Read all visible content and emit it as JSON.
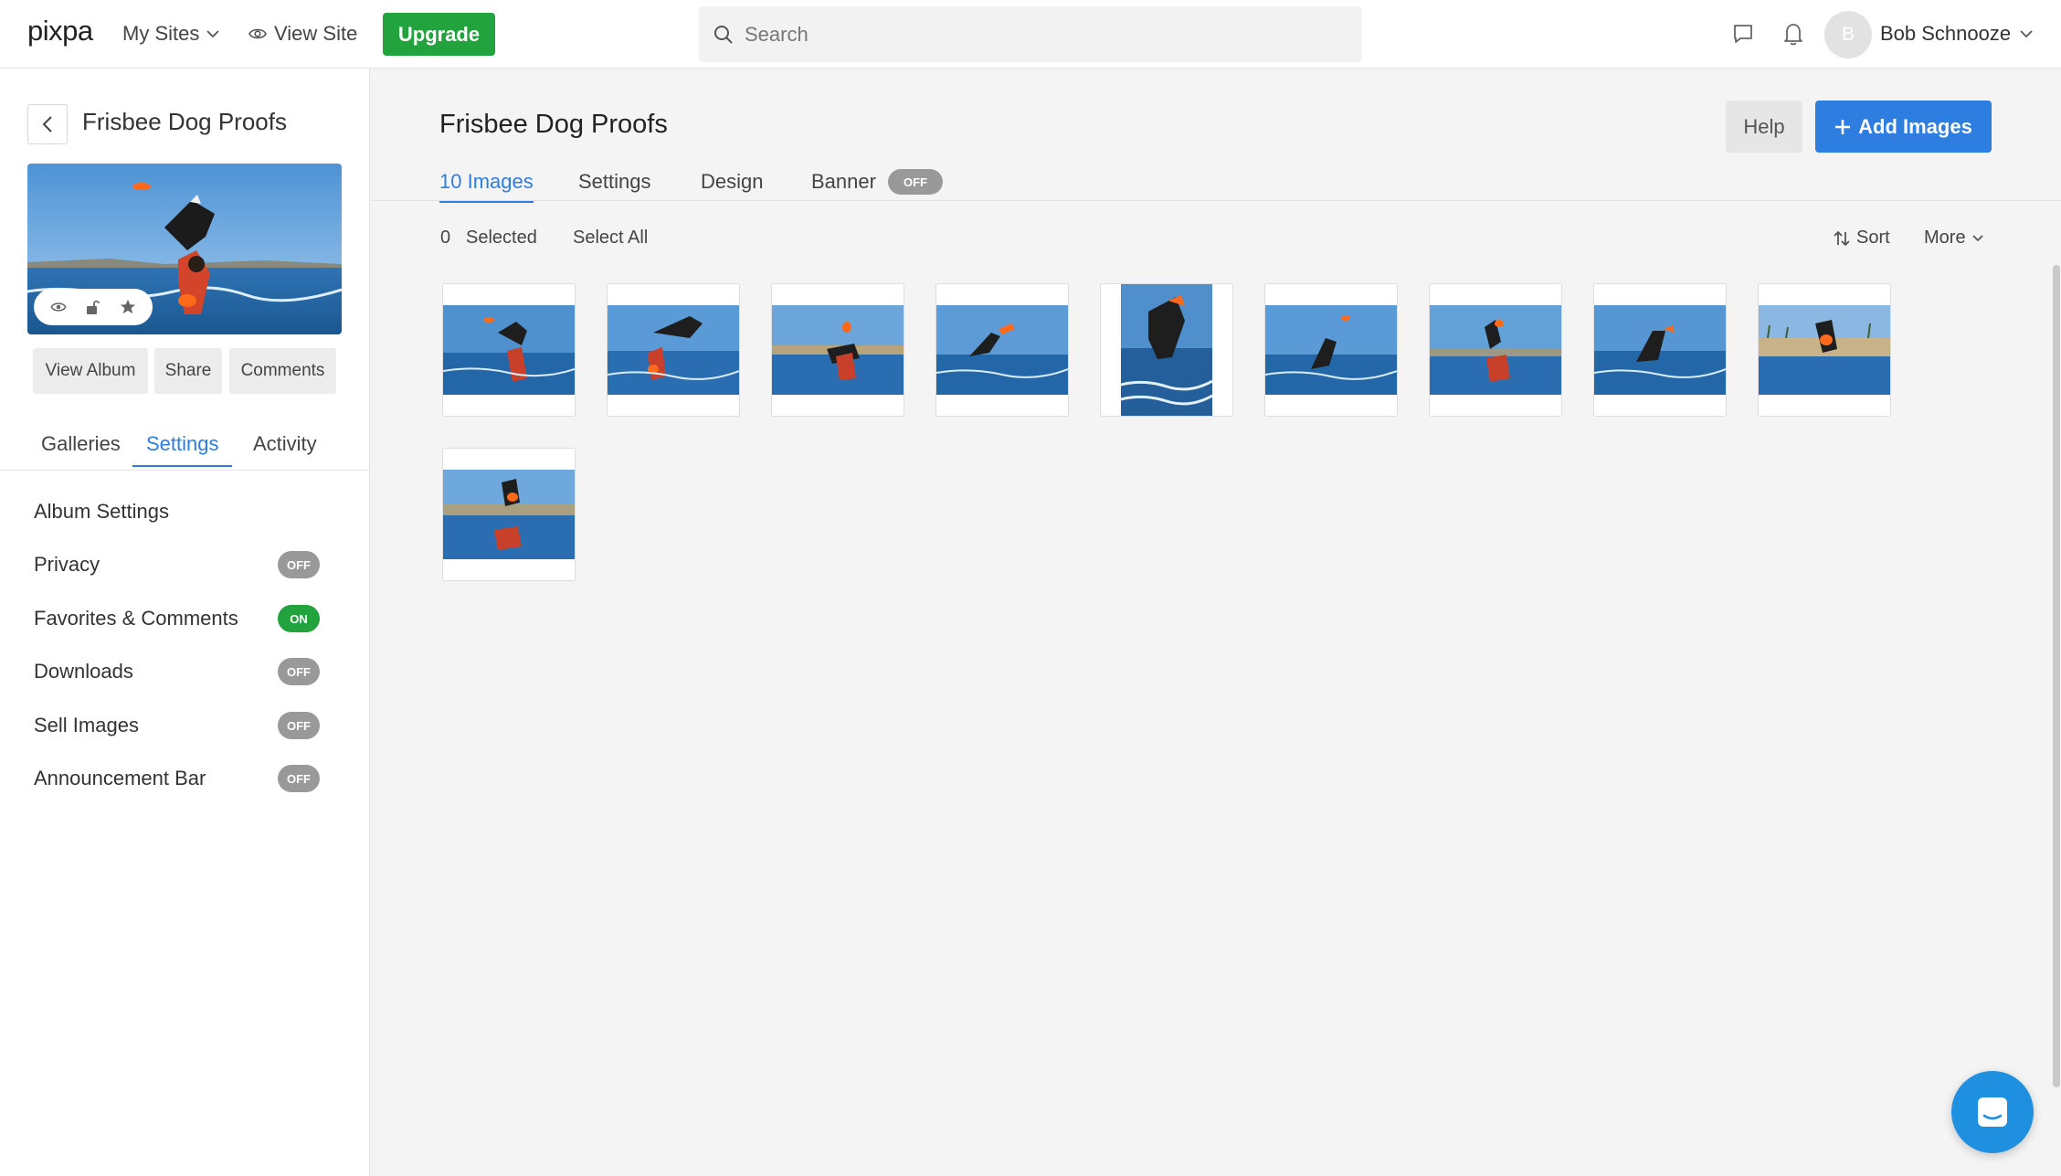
{
  "topbar": {
    "logo": "pixpa",
    "my_sites": "My Sites",
    "view_site": "View Site",
    "upgrade": "Upgrade",
    "search_placeholder": "Search",
    "avatar_initial": "B",
    "user_name": "Bob Schnooze"
  },
  "sidebar": {
    "album_title": "Frisbee Dog Proofs",
    "buttons": {
      "view_album": "View Album",
      "share": "Share",
      "comments": "Comments"
    },
    "tabs": [
      {
        "label": "Galleries",
        "active": false
      },
      {
        "label": "Settings",
        "active": true
      },
      {
        "label": "Activity",
        "active": false
      }
    ],
    "menu": [
      {
        "label": "Album Settings",
        "toggle": null
      },
      {
        "label": "Privacy",
        "toggle": "OFF"
      },
      {
        "label": "Favorites & Comments",
        "toggle": "ON"
      },
      {
        "label": "Downloads",
        "toggle": "OFF"
      },
      {
        "label": "Sell Images",
        "toggle": "OFF"
      },
      {
        "label": "Announcement Bar",
        "toggle": "OFF"
      }
    ]
  },
  "main": {
    "title": "Frisbee Dog Proofs",
    "help": "Help",
    "add_images": "Add Images",
    "tabs": [
      {
        "label": "10 Images",
        "active": true
      },
      {
        "label": "Settings",
        "active": false
      },
      {
        "label": "Design",
        "active": false
      },
      {
        "label": "Banner",
        "active": false
      }
    ],
    "banner_toggle": "OFF",
    "selected_count": "0",
    "selected_label": "Selected",
    "select_all": "Select All",
    "sort": "Sort",
    "more": "More",
    "image_count": 10
  },
  "colors": {
    "accent": "#2d7ee0",
    "upgrade_green": "#22a33d",
    "toggle_off": "#999999",
    "chat": "#1f8fe0"
  }
}
